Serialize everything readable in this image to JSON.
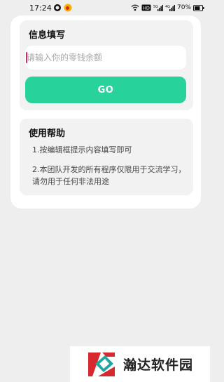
{
  "status_bar": {
    "time": "17:24",
    "battery": "70%",
    "icons": [
      "q-app-icon",
      "weibo-icon",
      "wifi-icon",
      "hd-icon",
      "signal-5g-icon",
      "signal-4g-icon",
      "battery-icon"
    ],
    "hd_label": "HD",
    "signal_labels": [
      "5G",
      "4G"
    ]
  },
  "info_section": {
    "title": "信息填写",
    "input": {
      "placeholder": "请输入你的零钱余额",
      "value": ""
    },
    "go_button_label": "GO"
  },
  "help_section": {
    "title": "使用帮助",
    "lines": [
      "1.按编辑框提示内容填写即可",
      "2.本团队开发的所有程序仅限用于交流学习，请勿用于任何非法用途"
    ]
  },
  "watermark": {
    "text": "瀚达软件园"
  },
  "colors": {
    "background": "#eeeeee",
    "card": "#ffffff",
    "panel": "#f2f2f2",
    "accent": "#27d39a",
    "caret": "#e0245e"
  }
}
